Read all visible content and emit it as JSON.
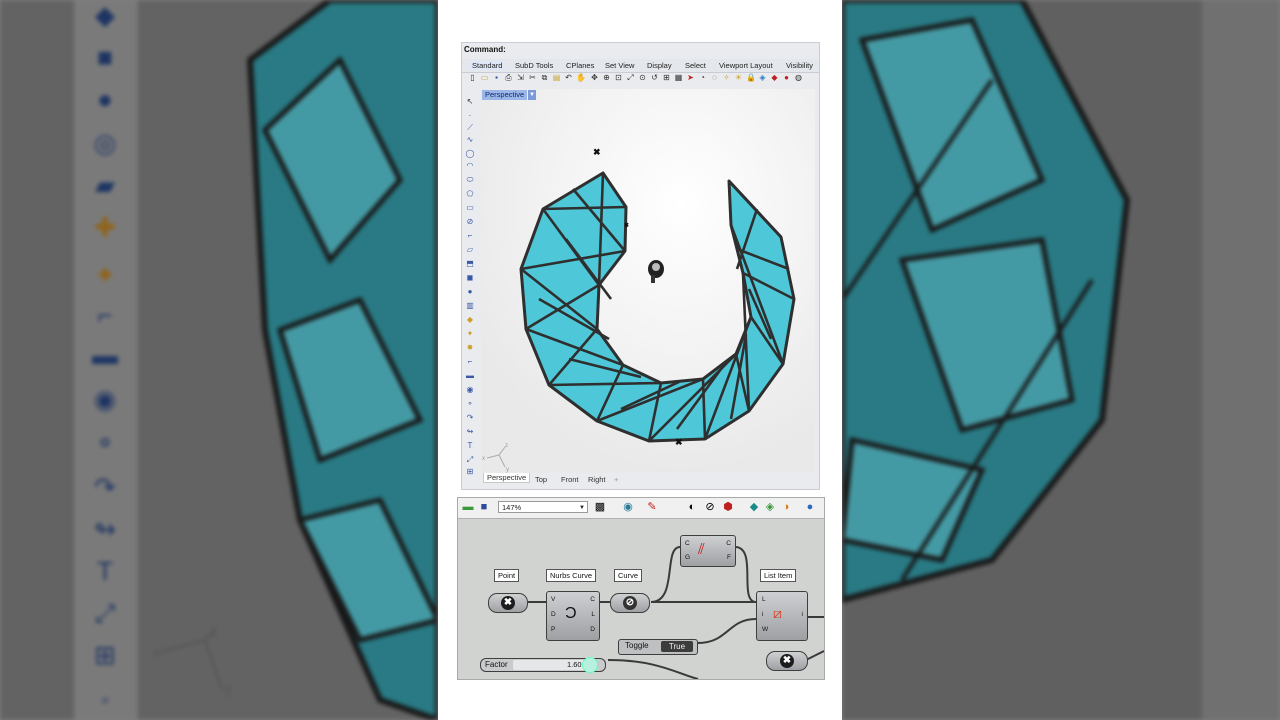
{
  "rhino": {
    "command_label": "Command:",
    "tabs": [
      "Standard",
      "SubD Tools",
      "CPlanes",
      "Set View",
      "Display",
      "Select",
      "Viewport Layout",
      "Visibility"
    ],
    "active_viewport": "Perspective",
    "viewport_tabs": [
      "Perspective",
      "Top",
      "Front",
      "Right"
    ],
    "add_viewport_symbol": "+",
    "axis_labels": {
      "z": "z",
      "y": "y",
      "x": "x"
    }
  },
  "grasshopper": {
    "zoom": "147%",
    "components": {
      "point": "Point",
      "nurbs_curve": "Nurbs Curve",
      "curve": "Curve",
      "list_item": "List Item"
    },
    "nurbs_ports": {
      "inputs": [
        "V",
        "D",
        "P"
      ],
      "outputs": [
        "C",
        "L",
        "D"
      ]
    },
    "middle_ports": {
      "inputs": [
        "C",
        "G"
      ],
      "outputs": [
        "C",
        "F"
      ]
    },
    "list_ports": {
      "inputs": [
        "L",
        "i",
        "W"
      ],
      "outputs": [
        "i"
      ]
    },
    "toggle": {
      "name": "Toggle",
      "value": "True"
    },
    "slider": {
      "name": "Factor",
      "value": "1.60"
    }
  },
  "colors": {
    "mesh_panel": "#4ec8d8",
    "mesh_frame": "#2f2f2f",
    "rhino_tab_active": "#9db6e8"
  }
}
